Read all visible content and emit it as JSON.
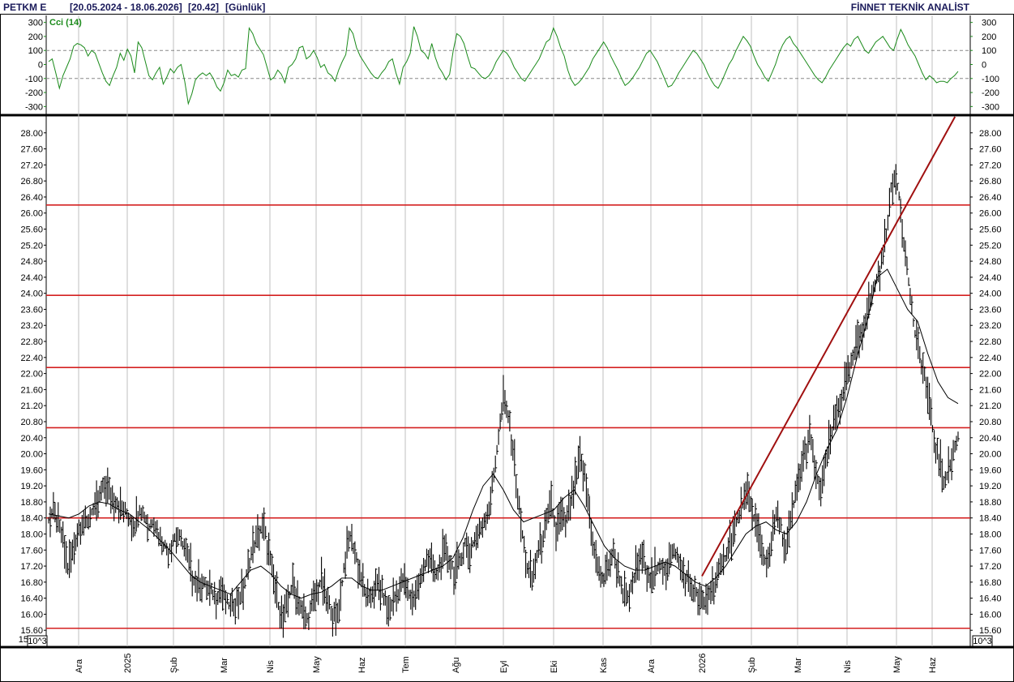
{
  "header": {
    "symbol": "PETKM E",
    "range": "[20.05.2024 - 18.06.2026]",
    "last": "[20.42]",
    "period": "[Günlük]",
    "brand": "FİNNET TEKNİK ANALİST"
  },
  "colors": {
    "cci": "#1a8a1a",
    "levels": "#d42020",
    "trend": "#a01010",
    "price": "#000000",
    "grid": "#bfbfbf"
  },
  "chart_data": [
    {
      "type": "line",
      "title": "Cci (14)",
      "ylim": [
        -350,
        350
      ],
      "yticks": [
        300,
        200,
        100,
        0,
        -100,
        -200,
        -300
      ],
      "ytick_labels": [
        "300",
        "200",
        "100",
        "0",
        "-100",
        "-200",
        "-300"
      ],
      "reference_lines": [
        100,
        -100
      ],
      "series": [
        {
          "name": "Cci (14)",
          "values": [
            20,
            40,
            -60,
            -170,
            -80,
            -20,
            40,
            130,
            150,
            140,
            120,
            60,
            100,
            80,
            10,
            -60,
            -120,
            -150,
            -80,
            -20,
            80,
            30,
            110,
            60,
            -60,
            160,
            120,
            20,
            -80,
            -110,
            -60,
            -20,
            -140,
            -90,
            -30,
            -60,
            -20,
            0,
            -120,
            -280,
            -210,
            -110,
            -80,
            -60,
            -80,
            -60,
            -100,
            -160,
            -190,
            -130,
            -40,
            -80,
            -70,
            -90,
            -40,
            -30,
            260,
            220,
            150,
            110,
            70,
            -20,
            -110,
            -90,
            -40,
            -70,
            -130,
            -20,
            0,
            40,
            120,
            130,
            40,
            60,
            100,
            50,
            -20,
            0,
            -60,
            -80,
            -120,
            -40,
            20,
            70,
            260,
            220,
            120,
            60,
            20,
            -20,
            -60,
            -90,
            -100,
            -60,
            -30,
            20,
            40,
            -60,
            -140,
            -20,
            20,
            80,
            270,
            200,
            100,
            80,
            40,
            150,
            50,
            -20,
            -60,
            -110,
            -70,
            100,
            220,
            200,
            150,
            60,
            -20,
            -30,
            -60,
            -90,
            -100,
            -80,
            -40,
            20,
            60,
            100,
            80,
            40,
            -20,
            -60,
            -100,
            -120,
            -80,
            -40,
            0,
            40,
            100,
            160,
            180,
            260,
            200,
            120,
            60,
            -40,
            -110,
            -150,
            -130,
            -100,
            -60,
            -20,
            40,
            80,
            120,
            160,
            120,
            60,
            10,
            -40,
            -100,
            -150,
            -130,
            -100,
            -60,
            -20,
            30,
            80,
            100,
            60,
            20,
            -40,
            -100,
            -160,
            -150,
            -110,
            -60,
            -20,
            20,
            60,
            100,
            80,
            40,
            0,
            -60,
            -110,
            -150,
            -170,
            -120,
            -60,
            0,
            40,
            100,
            150,
            200,
            170,
            130,
            60,
            0,
            -40,
            -90,
            -120,
            -60,
            0,
            80,
            140,
            180,
            200,
            150,
            120,
            80,
            40,
            0,
            -40,
            -80,
            -110,
            -130,
            -90,
            -40,
            0,
            40,
            80,
            120,
            150,
            130,
            180,
            200,
            150,
            100,
            80,
            120,
            160,
            180,
            200,
            160,
            120,
            100,
            180,
            250,
            200,
            140,
            100,
            60,
            0,
            -60,
            -110,
            -80,
            -100,
            -130,
            -120,
            -120,
            -130,
            -100,
            -80,
            -50
          ],
          "values_note_x": "index over trading days 20.05.2024 - 18.06.2026"
        }
      ]
    },
    {
      "type": "candlestick",
      "ylim": [
        15.2,
        28.4
      ],
      "yticks": [
        28.0,
        27.6,
        27.2,
        26.8,
        26.4,
        26.0,
        25.6,
        25.2,
        24.8,
        24.4,
        24.0,
        23.6,
        23.2,
        22.8,
        22.4,
        22.0,
        21.6,
        21.2,
        20.8,
        20.4,
        20.0,
        19.6,
        19.2,
        18.8,
        18.4,
        18.0,
        17.6,
        17.2,
        16.8,
        16.4,
        16.0,
        15.6,
        15.2
      ],
      "ytick_labels": [
        "28.00",
        "27.60",
        "27.20",
        "26.80",
        "26.40",
        "26.00",
        "25.60",
        "25.20",
        "24.80",
        "24.40",
        "24.00",
        "23.60",
        "23.20",
        "22.80",
        "22.40",
        "22.00",
        "21.60",
        "21.20",
        "20.80",
        "20.40",
        "20.00",
        "19.60",
        "19.20",
        "18.80",
        "18.40",
        "18.00",
        "17.60",
        "17.20",
        "16.80",
        "16.40",
        "16.00",
        "15.60",
        "15.20"
      ],
      "left_bottom_tick": "15.",
      "scale_badge": "10^3",
      "x_labels": [
        "Ara",
        "2025",
        "Şub",
        "Mar",
        "Nis",
        "May",
        "Haz",
        "Tem",
        "Ağu",
        "Eyl",
        "Eki",
        "Kas",
        "Ara",
        "2026",
        "Şub",
        "Mar",
        "Nis",
        "May",
        "Haz"
      ],
      "support_resistance_levels": [
        26.2,
        23.95,
        22.15,
        20.65,
        18.4,
        15.65
      ],
      "trendline": {
        "from": [
          "2026-01-01",
          16.95
        ],
        "to": [
          "2026-06-16",
          28.4
        ]
      },
      "close_path": [
        18.4,
        18.6,
        18.3,
        17.9,
        17.2,
        17.6,
        18.1,
        18.4,
        18.3,
        18.6,
        18.7,
        19.1,
        19.3,
        19.0,
        18.9,
        18.7,
        18.6,
        18.4,
        18.3,
        18.7,
        18.5,
        18.2,
        18.4,
        18.0,
        17.8,
        17.6,
        17.9,
        18.0,
        17.8,
        17.5,
        17.0,
        16.8,
        16.9,
        16.7,
        16.6,
        16.5,
        16.7,
        16.4,
        16.2,
        16.4,
        16.5,
        16.8,
        17.4,
        17.8,
        18.1,
        18.2,
        17.6,
        16.9,
        16.3,
        15.9,
        16.4,
        16.8,
        16.5,
        16.1,
        15.9,
        16.3,
        16.6,
        16.9,
        16.4,
        16.2,
        15.9,
        16.5,
        17.5,
        18.0,
        17.6,
        17.1,
        16.6,
        16.4,
        16.7,
        16.8,
        16.5,
        16.1,
        16.4,
        16.6,
        16.9,
        16.6,
        16.4,
        16.7,
        17.0,
        17.5,
        17.3,
        17.0,
        17.4,
        17.6,
        17.3,
        17.1,
        17.4,
        17.8,
        17.6,
        17.9,
        18.1,
        18.4,
        18.7,
        19.5,
        20.5,
        21.4,
        21.0,
        20.2,
        19.0,
        18.0,
        17.2,
        16.9,
        17.5,
        17.9,
        18.3,
        18.8,
        18.1,
        18.5,
        18.3,
        18.8,
        19.3,
        19.9,
        19.5,
        18.6,
        17.6,
        17.1,
        16.9,
        17.3,
        17.6,
        17.1,
        16.6,
        16.4,
        16.8,
        17.3,
        17.5,
        17.2,
        16.9,
        17.1,
        17.3,
        17.2,
        17.5,
        17.6,
        17.2,
        17.0,
        16.8,
        16.6,
        16.4,
        16.3,
        16.6,
        16.8,
        17.1,
        17.3,
        17.8,
        18.1,
        18.4,
        18.8,
        19.0,
        18.6,
        18.2,
        17.6,
        17.3,
        17.9,
        18.5,
        18.2,
        17.6,
        18.3,
        19.0,
        19.6,
        20.1,
        20.5,
        19.8,
        19.1,
        19.6,
        20.2,
        20.8,
        21.2,
        21.6,
        22.0,
        22.4,
        22.8,
        23.2,
        23.6,
        24.0,
        24.4,
        24.8,
        25.6,
        26.6,
        27.0,
        26.2,
        25.0,
        24.0,
        23.0,
        22.5,
        22.0,
        21.2,
        20.4,
        19.9,
        19.4,
        19.6,
        20.1,
        20.42
      ],
      "moving_average": [
        18.5,
        18.45,
        18.4,
        18.5,
        18.7,
        18.8,
        18.75,
        18.6,
        18.5,
        18.3,
        18.1,
        17.85,
        17.6,
        17.3,
        17.0,
        16.8,
        16.7,
        16.6,
        16.5,
        16.8,
        17.1,
        17.2,
        17.0,
        16.7,
        16.5,
        16.4,
        16.5,
        16.55,
        16.7,
        16.9,
        16.9,
        16.7,
        16.6,
        16.6,
        16.7,
        16.8,
        16.9,
        17.0,
        17.1,
        17.2,
        17.4,
        17.9,
        18.6,
        19.2,
        19.5,
        19.1,
        18.6,
        18.3,
        18.4,
        18.5,
        18.6,
        18.9,
        19.1,
        18.7,
        18.2,
        17.7,
        17.4,
        17.2,
        17.1,
        17.1,
        17.2,
        17.3,
        17.2,
        17.0,
        16.8,
        16.7,
        16.9,
        17.2,
        17.6,
        18.0,
        18.2,
        18.3,
        18.1,
        18.0,
        18.3,
        18.8,
        19.5,
        20.1,
        20.6,
        21.4,
        22.4,
        23.3,
        24.4,
        24.6,
        24.1,
        23.6,
        23.3,
        22.5,
        21.8,
        21.4,
        21.25
      ]
    }
  ]
}
